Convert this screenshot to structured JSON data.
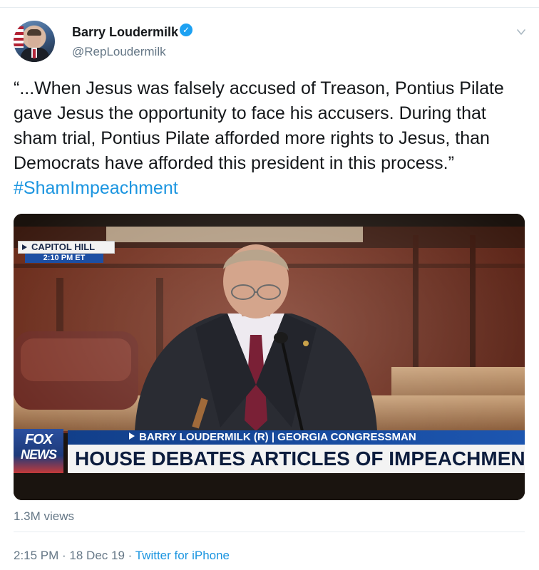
{
  "tweet": {
    "author_name": "Barry Loudermilk",
    "handle": "@RepLoudermilk",
    "verified_icon": "verified-badge-icon",
    "text_main": "“...When Jesus was falsely accused of Treason, Pontius Pilate gave Jesus the opportunity to face his accusers. During that sham trial, Pontius Pilate afforded more rights to Jesus, than Democrats have afforded this president in this process.” ",
    "hashtag": "#ShamImpeachment",
    "views": "1.3M views",
    "time": "2:15 PM",
    "sep1": " · ",
    "date": "18 Dec 19",
    "sep2": " · ",
    "source": "Twitter for iPhone"
  },
  "video": {
    "location_bug": "CAPITOL HILL",
    "bug_time": "2:10 PM ET",
    "network_line1": "FOX",
    "network_line2": "NEWS",
    "subtitle": "BARRY LOUDERMILK (R) | GEORGIA CONGRESSMAN",
    "headline": "HOUSE DEBATES ARTICLES OF IMPEACHMENT"
  },
  "colors": {
    "link_blue": "#1b95e0",
    "verified_blue": "#1da1f2",
    "secondary_text": "#657786"
  }
}
